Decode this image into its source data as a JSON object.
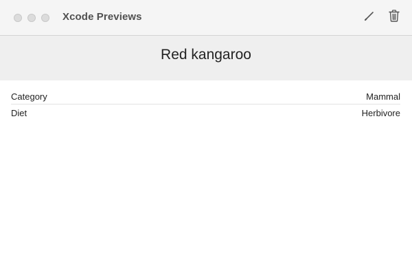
{
  "window": {
    "title": "Xcode Previews"
  },
  "toolbar": {
    "edit_icon": "pencil-icon",
    "delete_icon": "trash-icon"
  },
  "header": {
    "title": "Red kangaroo"
  },
  "details": [
    {
      "label": "Category",
      "value": "Mammal"
    },
    {
      "label": "Diet",
      "value": "Herbivore"
    }
  ],
  "colors": {
    "titlebar_bg": "#f5f5f5",
    "header_bg": "#efefef",
    "text": "#1f1f1f"
  }
}
